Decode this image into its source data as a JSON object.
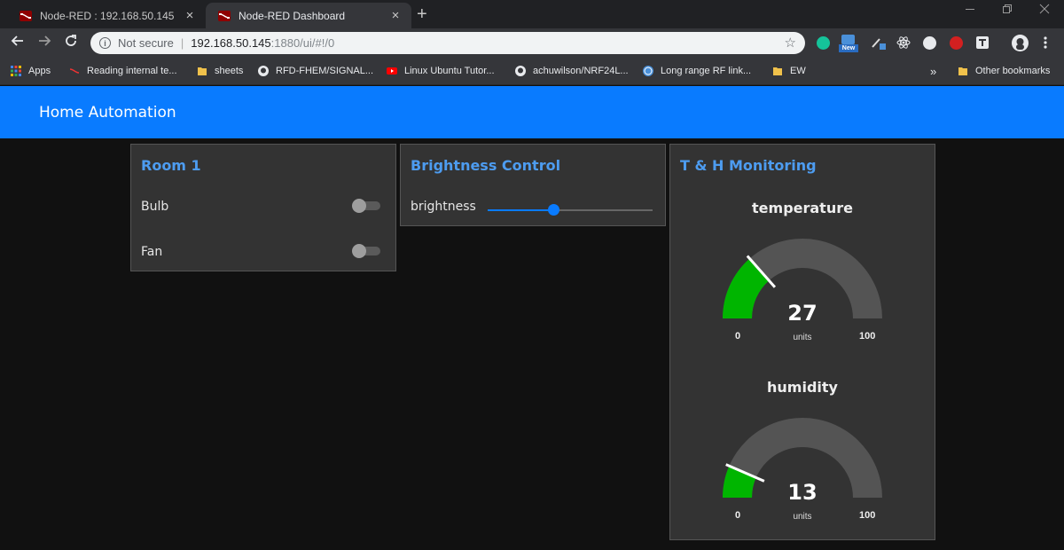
{
  "browser": {
    "tabs": [
      {
        "title": "Node-RED : 192.168.50.145",
        "active": false
      },
      {
        "title": "Node-RED Dashboard",
        "active": true
      }
    ],
    "close_glyph": "×",
    "newtab_glyph": "+",
    "address": {
      "security": "Not secure",
      "host": "192.168.50.145",
      "path": ":1880/ui/#!/0"
    },
    "bookmarks": [
      {
        "label": "Apps",
        "icon": "apps-grid-icon"
      },
      {
        "label": "Reading internal te...",
        "icon": "node-red-icon"
      },
      {
        "label": "sheets",
        "icon": "folder-icon"
      },
      {
        "label": "RFD-FHEM/SIGNAL...",
        "icon": "github-icon"
      },
      {
        "label": "Linux Ubuntu Tutor...",
        "icon": "youtube-icon"
      },
      {
        "label": "achuwilson/NRF24L...",
        "icon": "github-icon"
      },
      {
        "label": "Long range RF link...",
        "icon": "wordpress-icon"
      },
      {
        "label": "EW",
        "icon": "folder-icon"
      }
    ],
    "bookmarks_overflow": "»",
    "other_bookmarks": "Other bookmarks",
    "ext_new_badge": "New"
  },
  "dashboard": {
    "title": "Home Automation",
    "accent": "#097bff",
    "groups": {
      "room": {
        "title": "Room 1",
        "switches": [
          {
            "label": "Bulb",
            "on": false
          },
          {
            "label": "Fan",
            "on": false
          }
        ]
      },
      "brightness": {
        "title": "Brightness Control",
        "label": "brightness",
        "value_fraction": 0.4
      },
      "monitoring": {
        "title": "T & H Monitoring",
        "gauges": [
          {
            "label": "temperature",
            "value": "27",
            "units": "units",
            "min": "0",
            "max": "100",
            "fill_color": "#00b500"
          },
          {
            "label": "humidity",
            "value": "13",
            "units": "units",
            "min": "0",
            "max": "100",
            "fill_color": "#00b500"
          }
        ]
      }
    }
  }
}
